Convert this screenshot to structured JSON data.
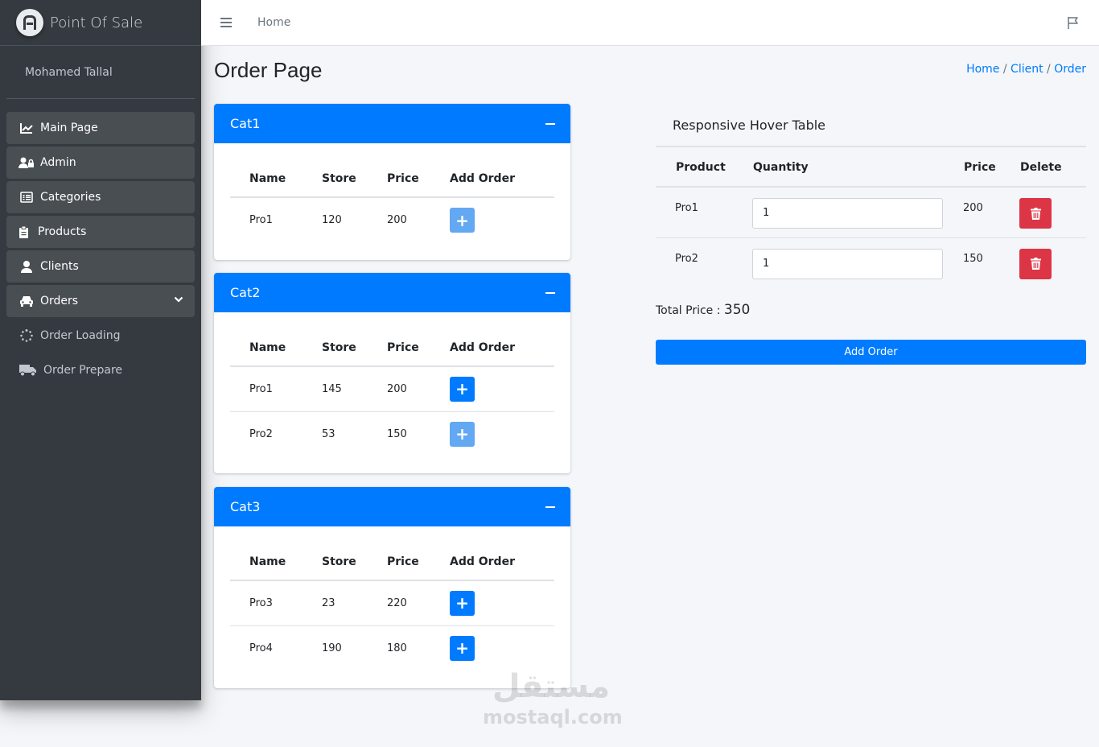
{
  "brand": {
    "name": "Point Of Sale"
  },
  "user": {
    "name": "Mohamed Tallal"
  },
  "sidebar": {
    "items": [
      {
        "label": "Main Page",
        "icon": "chart-line-icon"
      },
      {
        "label": "Admin",
        "icon": "user-lock-icon"
      },
      {
        "label": "Categories",
        "icon": "list-alt-icon"
      },
      {
        "label": "Products",
        "icon": "clipboard-icon"
      },
      {
        "label": "Clients",
        "icon": "user-icon"
      },
      {
        "label": "Orders",
        "icon": "car-icon"
      },
      {
        "label": "Order Loading",
        "icon": "spinner-icon"
      },
      {
        "label": "Order Prepare",
        "icon": "truck-icon"
      }
    ]
  },
  "topbar": {
    "home": "Home"
  },
  "page": {
    "title": "Order Page",
    "breadcrumb": {
      "home": "Home",
      "client": "Client",
      "order": "Order",
      "sep": "/"
    }
  },
  "table_headers": {
    "name": "Name",
    "store": "Store",
    "price": "Price",
    "add": "Add Order"
  },
  "categories": [
    {
      "title": "Cat1",
      "rows": [
        {
          "name": "Pro1",
          "store": "120",
          "price": "200"
        }
      ]
    },
    {
      "title": "Cat2",
      "rows": [
        {
          "name": "Pro1",
          "store": "145",
          "price": "200"
        },
        {
          "name": "Pro2",
          "store": "53",
          "price": "150"
        }
      ]
    },
    {
      "title": "Cat3",
      "rows": [
        {
          "name": "Pro3",
          "store": "23",
          "price": "220"
        },
        {
          "name": "Pro4",
          "store": "190",
          "price": "180"
        }
      ]
    }
  ],
  "order": {
    "title": "Responsive Hover Table",
    "headers": {
      "product": "Product",
      "quantity": "Quantity",
      "price": "Price",
      "delete": "Delete"
    },
    "rows": [
      {
        "product": "Pro1",
        "quantity": "1",
        "price": "200"
      },
      {
        "product": "Pro2",
        "quantity": "1",
        "price": "150"
      }
    ],
    "total_label": "Total Price :",
    "total_value": "350",
    "submit": "Add Order"
  },
  "watermark": {
    "arabic": "مستقل",
    "text": "mostaql.com"
  },
  "colors": {
    "primary": "#007bff",
    "danger": "#dc3545",
    "sidebar": "#343a40"
  }
}
